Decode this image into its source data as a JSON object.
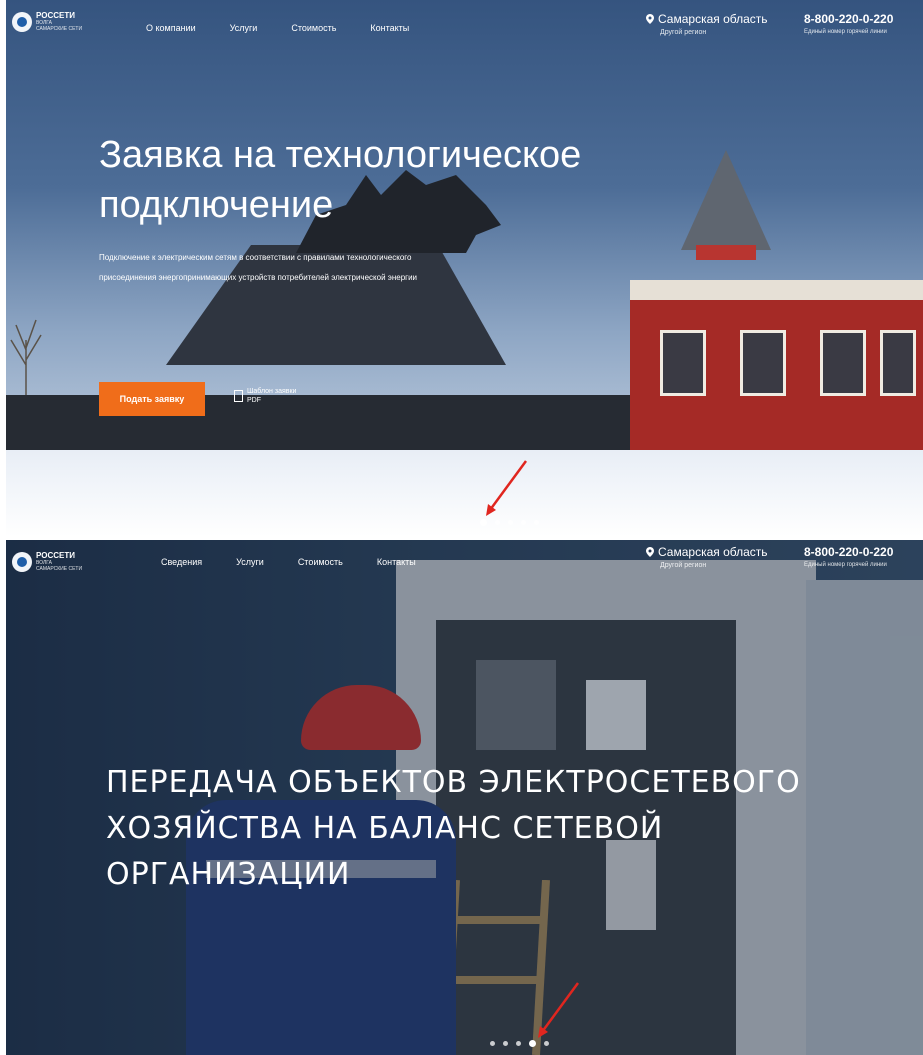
{
  "slide1": {
    "logo": {
      "name": "РОССЕТИ",
      "sub1": "ВОЛГА",
      "sub2": "САМАРСКИЕ СЕТИ"
    },
    "nav": [
      "О компании",
      "Услуги",
      "Стоимость",
      "Контакты"
    ],
    "region": {
      "name": "Самарская область",
      "sub": "Другой регион"
    },
    "phone": {
      "number": "8-800-220-0-220",
      "sub": "Единый номер горячей линии"
    },
    "hero": {
      "title_line1": "Заявка на технологическое",
      "title_line2": "подключение",
      "desc": "Подключение к электрическим сетям в соответствии с правилами технологического присоединения энергопринимающих устройств потребителей электрической энергии",
      "cta_label": "Подать заявку",
      "meta_line1": "Шаблон заявки",
      "meta_line2": "PDF"
    },
    "slider": {
      "count": 5,
      "active": 1
    },
    "colors": {
      "accent": "#f06d1a",
      "arrow": "#e0261f"
    }
  },
  "slide2": {
    "logo": {
      "name": "РОССЕТИ",
      "sub1": "ВОЛГА",
      "sub2": "САМАРСКИЕ СЕТИ"
    },
    "nav": [
      "Сведения",
      "Услуги",
      "Стоимость",
      "Контакты"
    ],
    "region": {
      "name": "Самарская область",
      "sub": "Другой регион"
    },
    "phone": {
      "number": "8-800-220-0-220",
      "sub": "Единый номер горячей линии"
    },
    "hero": {
      "title_line1": "ПЕРЕДАЧА ОБЪЕКТОВ ЭЛЕКТРОСЕТЕВОГО",
      "title_line2": "ХОЗЯЙСТВА НА БАЛАНС СЕТЕВОЙ",
      "title_line3": "ОРГАНИЗАЦИИ"
    },
    "slider": {
      "count": 5,
      "active": 4
    }
  }
}
